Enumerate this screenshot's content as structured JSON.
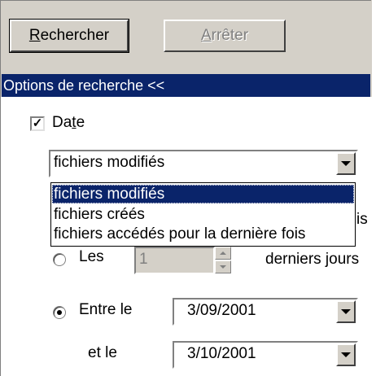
{
  "buttons": {
    "search_label": "Rechercher",
    "stop_label": "Arrêter"
  },
  "search_options": {
    "header": "Options de recherche <<",
    "date_checkbox_label": "Date",
    "date_checked": true,
    "date_type_selected": "fichiers modifiés",
    "date_type_options": [
      "fichiers modifiés",
      "fichiers créés",
      "fichiers accédés pour la dernière fois"
    ],
    "hidden_text_fragment": "is",
    "last_days": {
      "label": "Les",
      "value": "1",
      "suffix": "derniers jours",
      "selected": false
    },
    "between": {
      "label": "Entre le",
      "start_date": "3/09/2001",
      "and_label": "et le",
      "end_date": "3/10/2001",
      "selected": true
    }
  },
  "colors": {
    "panel": "#d4d0c8",
    "header_bg": "#0a246a",
    "selection": "#0a246a"
  }
}
